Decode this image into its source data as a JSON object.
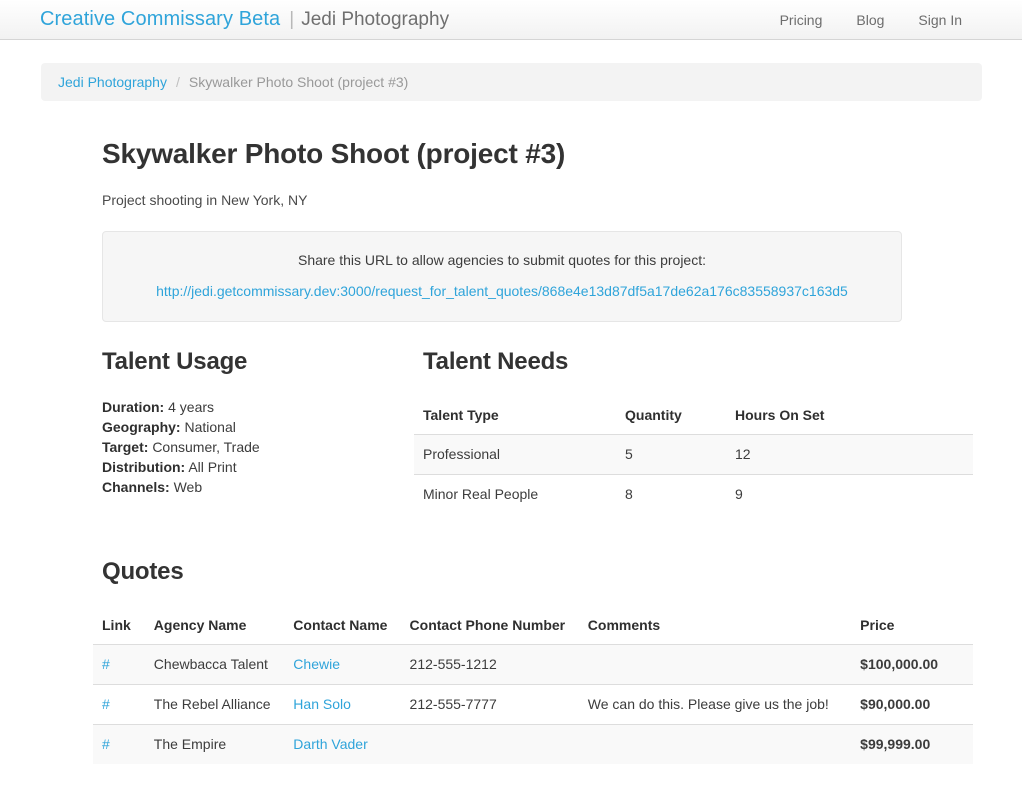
{
  "navbar": {
    "brand": "Creative Commissary Beta",
    "separator": "|",
    "subtitle": "Jedi Photography",
    "links": [
      {
        "label": "Pricing"
      },
      {
        "label": "Blog"
      },
      {
        "label": "Sign In"
      }
    ]
  },
  "breadcrumb": {
    "home": "Jedi Photography",
    "divider": "/",
    "current": "Skywalker Photo Shoot (project #3)"
  },
  "page": {
    "title": "Skywalker Photo Shoot (project #3)",
    "subtitle": "Project shooting in New York, NY"
  },
  "share": {
    "text": "Share this URL to allow agencies to submit quotes for this project:",
    "url": "http://jedi.getcommissary.dev:3000/request_for_talent_quotes/868e4e13d87df5a17de62a176c83558937c163d5"
  },
  "talent_usage": {
    "title": "Talent Usage",
    "fields": [
      {
        "label": "Duration:",
        "value": "4 years"
      },
      {
        "label": "Geography:",
        "value": "National"
      },
      {
        "label": "Target:",
        "value": "Consumer, Trade"
      },
      {
        "label": "Distribution:",
        "value": "All Print"
      },
      {
        "label": "Channels:",
        "value": "Web"
      }
    ]
  },
  "talent_needs": {
    "title": "Talent Needs",
    "columns": [
      "Talent Type",
      "Quantity",
      "Hours On Set"
    ],
    "rows": [
      {
        "type": "Professional",
        "quantity": "5",
        "hours": "12"
      },
      {
        "type": "Minor Real People",
        "quantity": "8",
        "hours": "9"
      }
    ]
  },
  "quotes": {
    "title": "Quotes",
    "columns": [
      "Link",
      "Agency Name",
      "Contact Name",
      "Contact Phone Number",
      "Comments",
      "Price"
    ],
    "rows": [
      {
        "link": "#",
        "agency": "Chewbacca Talent",
        "contact": "Chewie",
        "phone": "212-555-1212",
        "comments": "",
        "price": "$100,000.00"
      },
      {
        "link": "#",
        "agency": "The Rebel Alliance",
        "contact": "Han Solo",
        "phone": "212-555-7777",
        "comments": "We can do this. Please give us the job!",
        "price": "$90,000.00"
      },
      {
        "link": "#",
        "agency": "The Empire",
        "contact": "Darth Vader",
        "phone": "",
        "comments": "",
        "price": "$99,999.00"
      }
    ]
  },
  "colors": {
    "link": "#2fa4da",
    "text": "#333333",
    "muted": "#999999",
    "well_bg": "#f6f6f6",
    "stripe": "#f9f9f9"
  }
}
